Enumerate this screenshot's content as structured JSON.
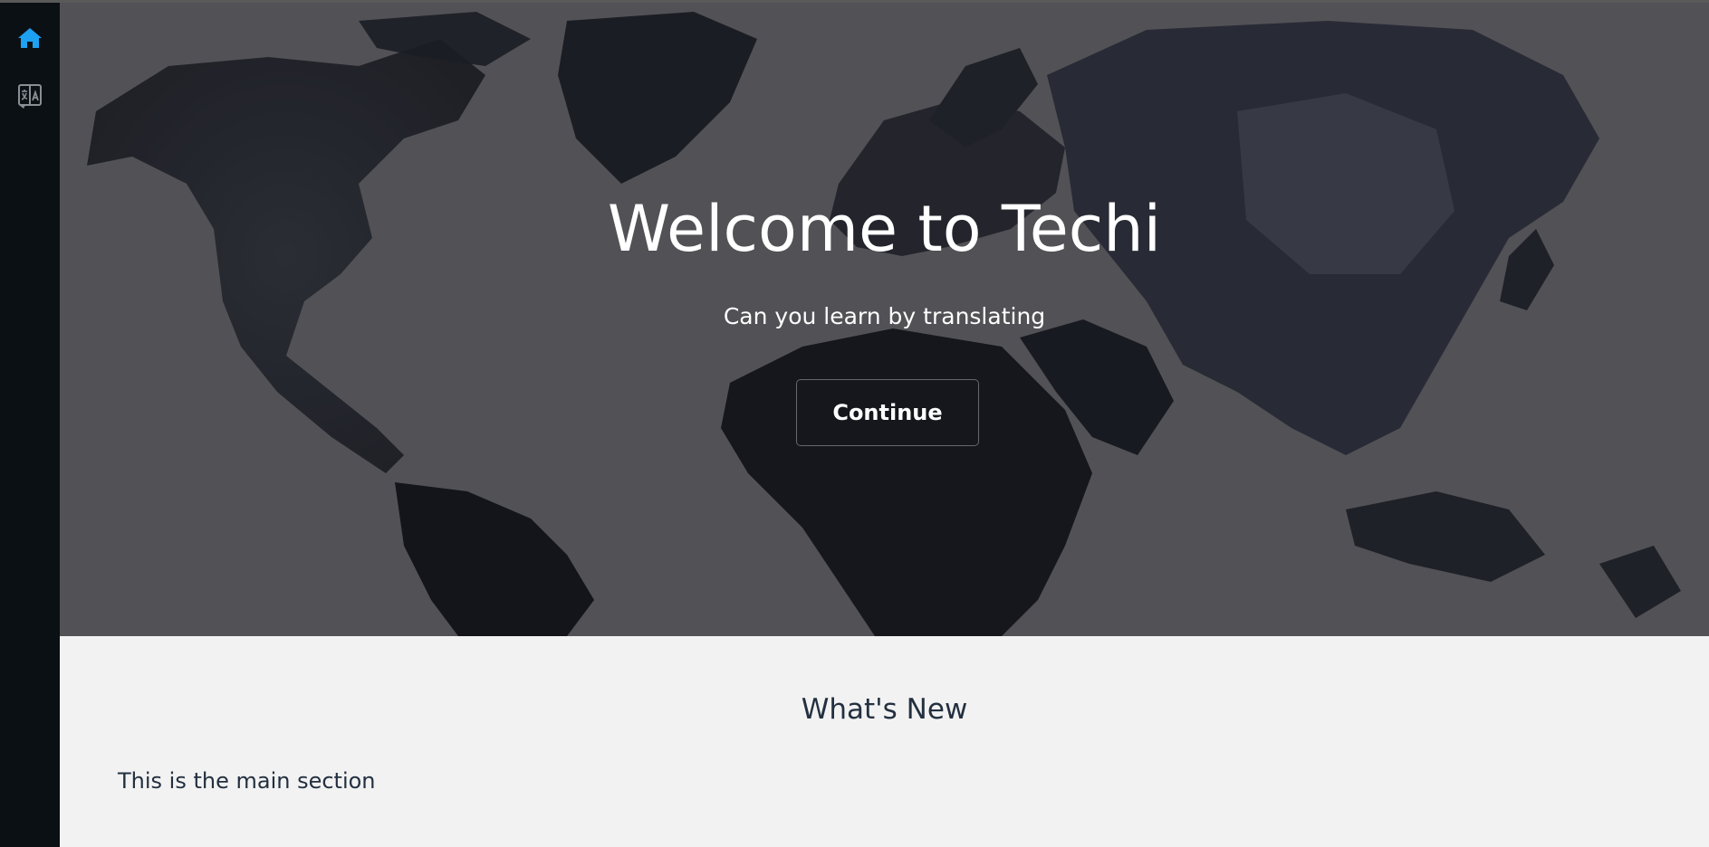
{
  "sidebar": {
    "home_icon": "home-icon",
    "translate_icon": "translate-icon",
    "active_color": "#1da1f2",
    "inactive_color": "#9aa0a6"
  },
  "hero": {
    "title": "Welcome to Techi",
    "subtitle": "Can you learn by translating",
    "button_label": "Continue",
    "background": "world-map"
  },
  "main": {
    "title": "What's New",
    "text": "This is the main section"
  }
}
